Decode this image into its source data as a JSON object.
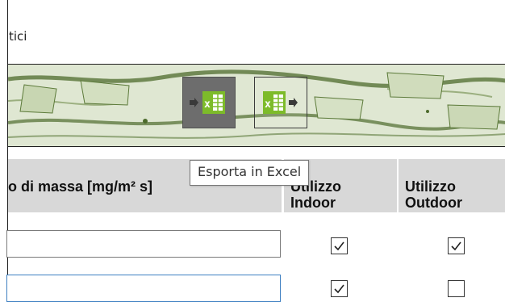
{
  "window": {
    "title": "tici"
  },
  "toolbar": {
    "export_excel_label": "x",
    "import_excel_label": "x"
  },
  "tooltip": {
    "text": "Esporta in Excel"
  },
  "table": {
    "headers": {
      "mass": "o di massa [mg/m² s]",
      "indoor": "Utilizzo\nIndoor",
      "outdoor": "Utilizzo\nOutdoor"
    },
    "rows": [
      {
        "value": "",
        "indoor": true,
        "outdoor": true,
        "focused": false
      },
      {
        "value": "",
        "indoor": true,
        "outdoor": false,
        "focused": true
      }
    ]
  },
  "colors": {
    "excel_green": "#7dbb2a",
    "focus_border": "#3d7fc1",
    "header_bg": "#d8d8d8",
    "active_button_bg": "#6d6d6d"
  }
}
